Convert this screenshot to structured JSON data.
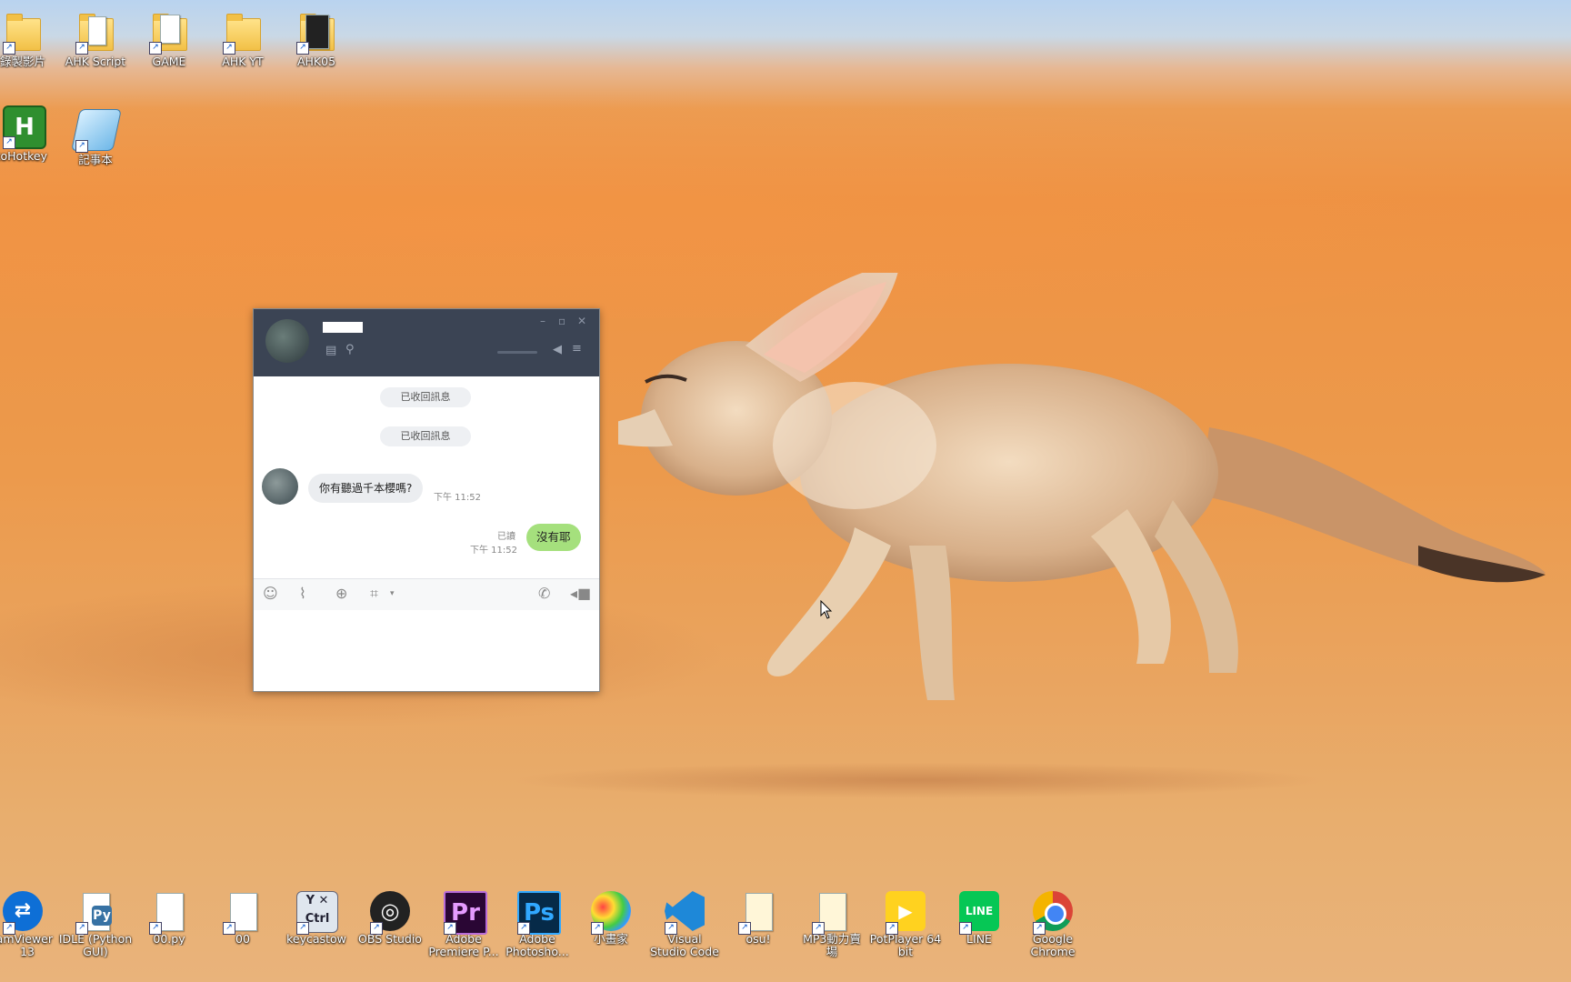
{
  "desktop_icons_top": [
    {
      "id": "folder1",
      "label": "錄製影片",
      "icon": "folder-icon"
    },
    {
      "id": "ahk_script",
      "label": "AHK Script",
      "icon": "folder-icon"
    },
    {
      "id": "game",
      "label": "GAME",
      "icon": "folder-icon"
    },
    {
      "id": "ahk_yt",
      "label": "AHK YT",
      "icon": "folder-icon"
    },
    {
      "id": "ahk05",
      "label": "AHK05",
      "icon": "folder-icon"
    }
  ],
  "desktop_icons_row2": [
    {
      "id": "autohotkey",
      "label": "utoHotkey",
      "icon": "autohotkey-icon"
    },
    {
      "id": "notepad",
      "label": "記事本",
      "icon": "notepad-icon"
    }
  ],
  "desktop_icons_bottom": [
    {
      "id": "teamviewer",
      "label": "amViewer",
      "label2": "13",
      "icon": "teamviewer-icon"
    },
    {
      "id": "idle",
      "label": "IDLE (Python",
      "label2": "GUI)",
      "icon": "python-icon"
    },
    {
      "id": "00py",
      "label": "00.py",
      "icon": "python-file-icon"
    },
    {
      "id": "00",
      "label": "00",
      "icon": "file-icon"
    },
    {
      "id": "keycastow",
      "label": "keycastow",
      "icon": "keyboard-icon"
    },
    {
      "id": "obs",
      "label": "OBS Studio",
      "icon": "obs-icon"
    },
    {
      "id": "premiere",
      "label": "Adobe",
      "label2": "Premiere P...",
      "icon": "premiere-icon"
    },
    {
      "id": "photoshop",
      "label": "Adobe",
      "label2": "Photosho...",
      "icon": "photoshop-icon"
    },
    {
      "id": "painter",
      "label": "小畫家",
      "icon": "paint-icon"
    },
    {
      "id": "vscode",
      "label": "Visual",
      "label2": "Studio Code",
      "icon": "vscode-icon"
    },
    {
      "id": "osu",
      "label": "osu!",
      "icon": "osu-file-icon"
    },
    {
      "id": "mp3",
      "label": "MP3動力賣",
      "label2": "場",
      "icon": "mp3-file-icon"
    },
    {
      "id": "potplayer",
      "label": "PotPlayer 64",
      "label2": "bit",
      "icon": "potplayer-icon"
    },
    {
      "id": "line",
      "label": "LINE",
      "icon": "line-icon"
    },
    {
      "id": "chrome",
      "label": "Google",
      "label2": "Chrome",
      "icon": "chrome-icon"
    }
  ],
  "chat": {
    "contact_name": "",
    "system_messages": [
      "已收回訊息",
      "已收回訊息"
    ],
    "incoming": {
      "text": "你有聽過千本櫻嗎?",
      "time": "下午 11:52"
    },
    "outgoing": {
      "text": "沒有耶",
      "read": "已讀",
      "time": "下午 11:52"
    }
  },
  "colors": {
    "header_bg": "#3b4454",
    "outgoing_bubble": "#a5e07d",
    "incoming_bubble": "#ebedf0",
    "sky": "#b9d3ef",
    "sand": "#ec9a4c"
  }
}
